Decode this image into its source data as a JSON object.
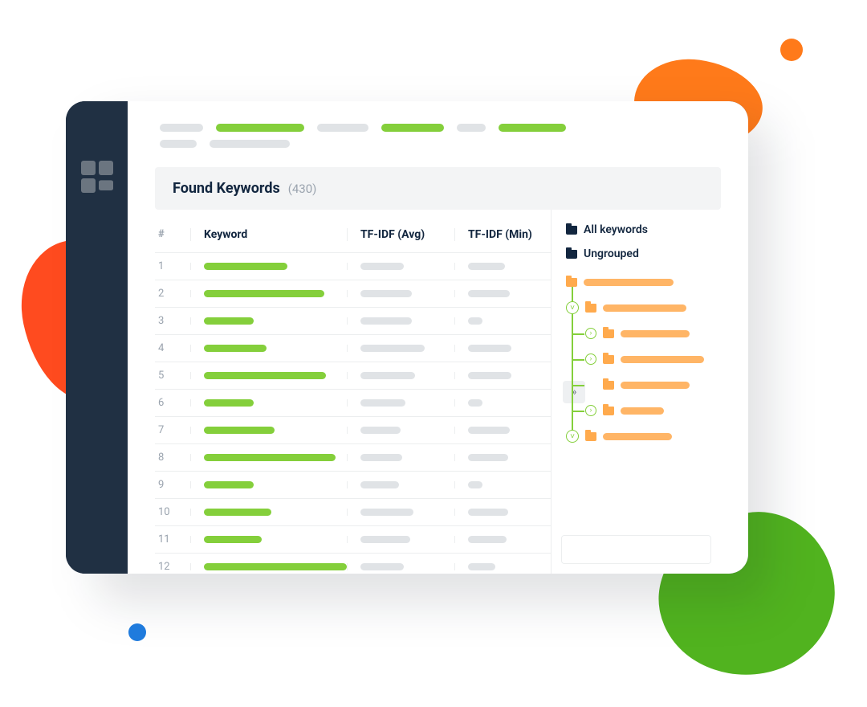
{
  "section": {
    "title": "Found Keywords",
    "count": "(430)"
  },
  "columns": {
    "num": "#",
    "keyword": "Keyword",
    "avg": "TF-IDF (Avg)",
    "min": "TF-IDF (Min)"
  },
  "rows": [
    {
      "n": "1",
      "kw": 104,
      "avg": 54,
      "min": 46
    },
    {
      "n": "2",
      "kw": 150,
      "avg": 64,
      "min": 52
    },
    {
      "n": "3",
      "kw": 62,
      "avg": 64,
      "min": 18
    },
    {
      "n": "4",
      "kw": 78,
      "avg": 80,
      "min": 54
    },
    {
      "n": "5",
      "kw": 152,
      "avg": 68,
      "min": 54
    },
    {
      "n": "6",
      "kw": 62,
      "avg": 56,
      "min": 18
    },
    {
      "n": "7",
      "kw": 88,
      "avg": 50,
      "min": 52
    },
    {
      "n": "8",
      "kw": 164,
      "avg": 52,
      "min": 50
    },
    {
      "n": "9",
      "kw": 62,
      "avg": 48,
      "min": 18
    },
    {
      "n": "10",
      "kw": 84,
      "avg": 66,
      "min": 50
    },
    {
      "n": "11",
      "kw": 72,
      "avg": 62,
      "min": 48
    },
    {
      "n": "12",
      "kw": 178,
      "avg": 54,
      "min": 34
    }
  ],
  "groups": {
    "all": "All keywords",
    "ungrouped": "Ungrouped",
    "nodes": [
      {
        "level": 0,
        "chev": "",
        "bar": 112
      },
      {
        "level": 0,
        "chev": "down",
        "bar": 104
      },
      {
        "level": 1,
        "chev": "right",
        "bar": 86
      },
      {
        "level": 1,
        "chev": "right",
        "bar": 104
      },
      {
        "level": 1,
        "chev": "",
        "bar": 86
      },
      {
        "level": 1,
        "chev": "right",
        "bar": 54
      },
      {
        "level": 0,
        "chev": "down",
        "bar": 86
      }
    ]
  }
}
